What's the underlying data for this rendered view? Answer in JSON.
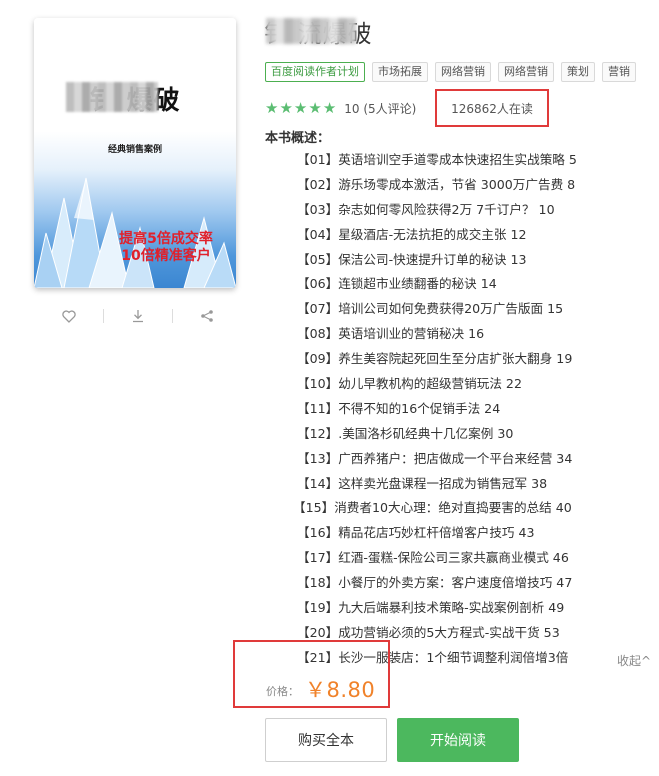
{
  "book": {
    "title": "钅  流爆破",
    "cover": {
      "title": "钅     爆破",
      "subtitle": "经典销售案例",
      "slogan_line1": "提高5倍成交率",
      "slogan_line2": "10倍精准客户"
    },
    "tags": [
      "百度阅读作者计划",
      "市场拓展",
      "网络营销",
      "网络营销",
      "策划",
      "营销"
    ],
    "rating": {
      "stars": 5,
      "text": "10 (5人评论)"
    },
    "readers": "126862人在读",
    "overview_label": "本书概述：",
    "toc": [
      "【01】英语培训空手道零成本快速招生实战策略 5",
      "【02】游乐场零成本激活，节省 3000万广告费 8",
      "【03】杂志如何零风险获得2万 7千订户？ 10",
      "【04】星级酒店-无法抗拒的成交主张 12",
      "【05】保洁公司-快速提升订单的秘诀 13",
      "【06】连锁超市业绩翻番的秘诀 14",
      "【07】培训公司如何免费获得20万广告版面 15",
      "【08】英语培训业的营销秘决 16",
      "【09】养生美容院起死回生至分店扩张大翻身 19",
      "【10】幼儿早教机构的超级营销玩法 22",
      "【11】不得不知的16个促销手法 24",
      "【12】.美国洛杉矶经典十几亿案例 30",
      "【13】广西养猪户：把店做成一个平台来经营 34",
      "【14】这样卖光盘课程一招成为销售冠军 38",
      "【15】消费者10大心理：绝对直捣要害的总结 40",
      "【16】精品花店巧妙杠杆倍增客户技巧 43",
      "【17】红酒-蛋糕-保险公司三家共赢商业模式 46",
      "【18】小餐厅的外卖方案：客户速度倍增技巧 47",
      "【19】九大后端暴利技术策略-实战案例剖析 49",
      "【20】成功营销必须的5大方程式-实战干货 53",
      "【21】长沙一服装店：1个细节调整利润倍增3倍"
    ],
    "collapse_label": "收起^"
  },
  "price": {
    "label": "价格：",
    "value": "￥8.80"
  },
  "actions": {
    "buy_label": "购买全本",
    "read_label": "开始阅读"
  },
  "colors": {
    "green": "#4cb85e",
    "star": "#5bbd72",
    "price": "#f0822a",
    "highlight": "#e03a3a"
  },
  "icons": [
    "heart-icon",
    "download-icon",
    "share-icon",
    "star-icon"
  ]
}
